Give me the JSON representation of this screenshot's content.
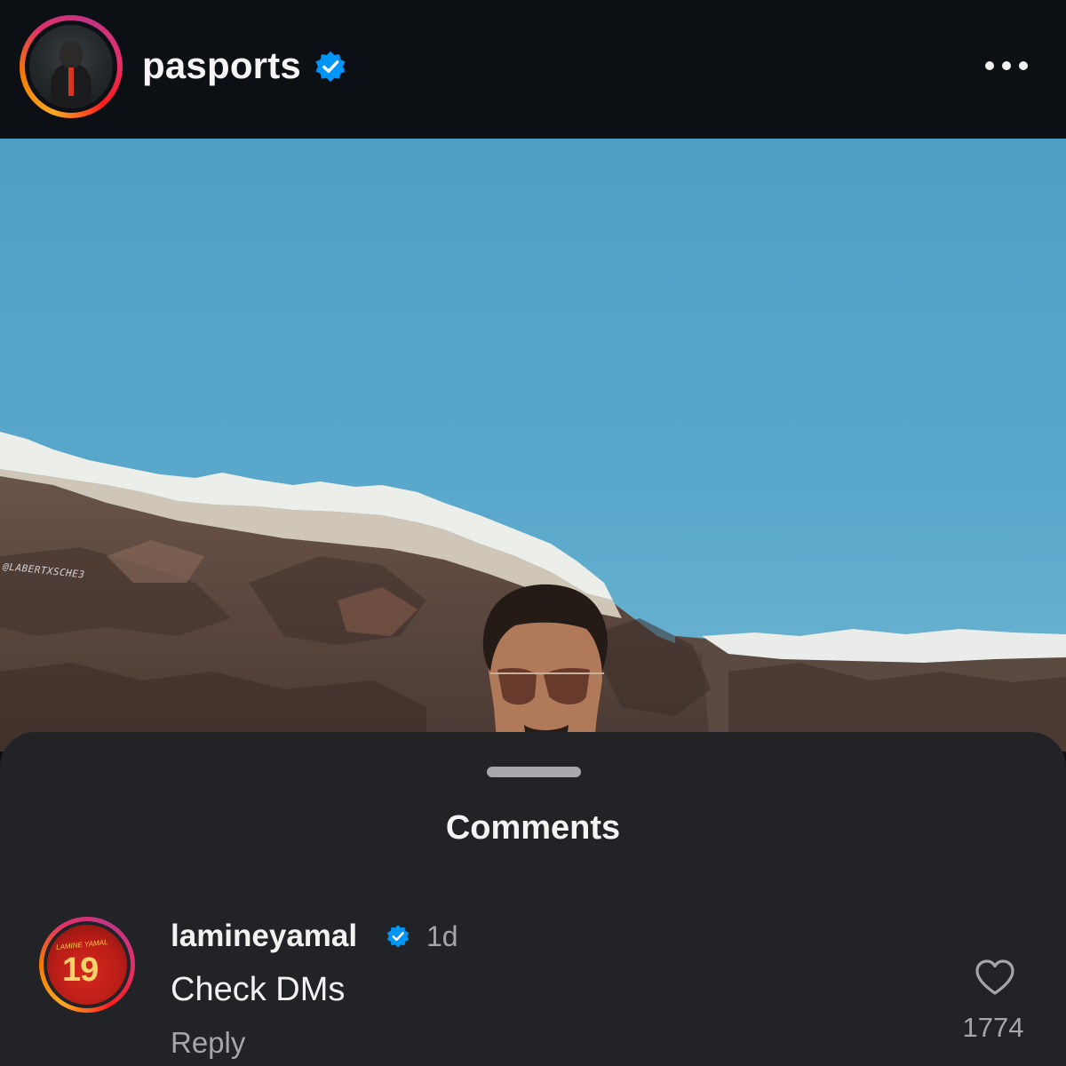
{
  "post": {
    "username": "pasports",
    "verified": true,
    "menu_icon": "more-horizontal-icon",
    "photo_watermark": "@LABERTXSCHE3"
  },
  "comments_sheet": {
    "title": "Comments",
    "items": [
      {
        "username": "lamineyamal",
        "verified": true,
        "time": "1d",
        "text": "Check DMs",
        "reply_label": "Reply",
        "like_icon": "heart-icon",
        "like_count": "1774",
        "avatar_jersey_text": "LAMINE YAMAL",
        "avatar_jersey_number": "19"
      }
    ]
  },
  "colors": {
    "header_bg": "#0c0f14",
    "sheet_bg": "#212327",
    "verified_blue": "#0095f6",
    "secondary_text": "#a4a6aa",
    "primary_text": "#f2f2f2",
    "sky": "#5aa7c9"
  }
}
